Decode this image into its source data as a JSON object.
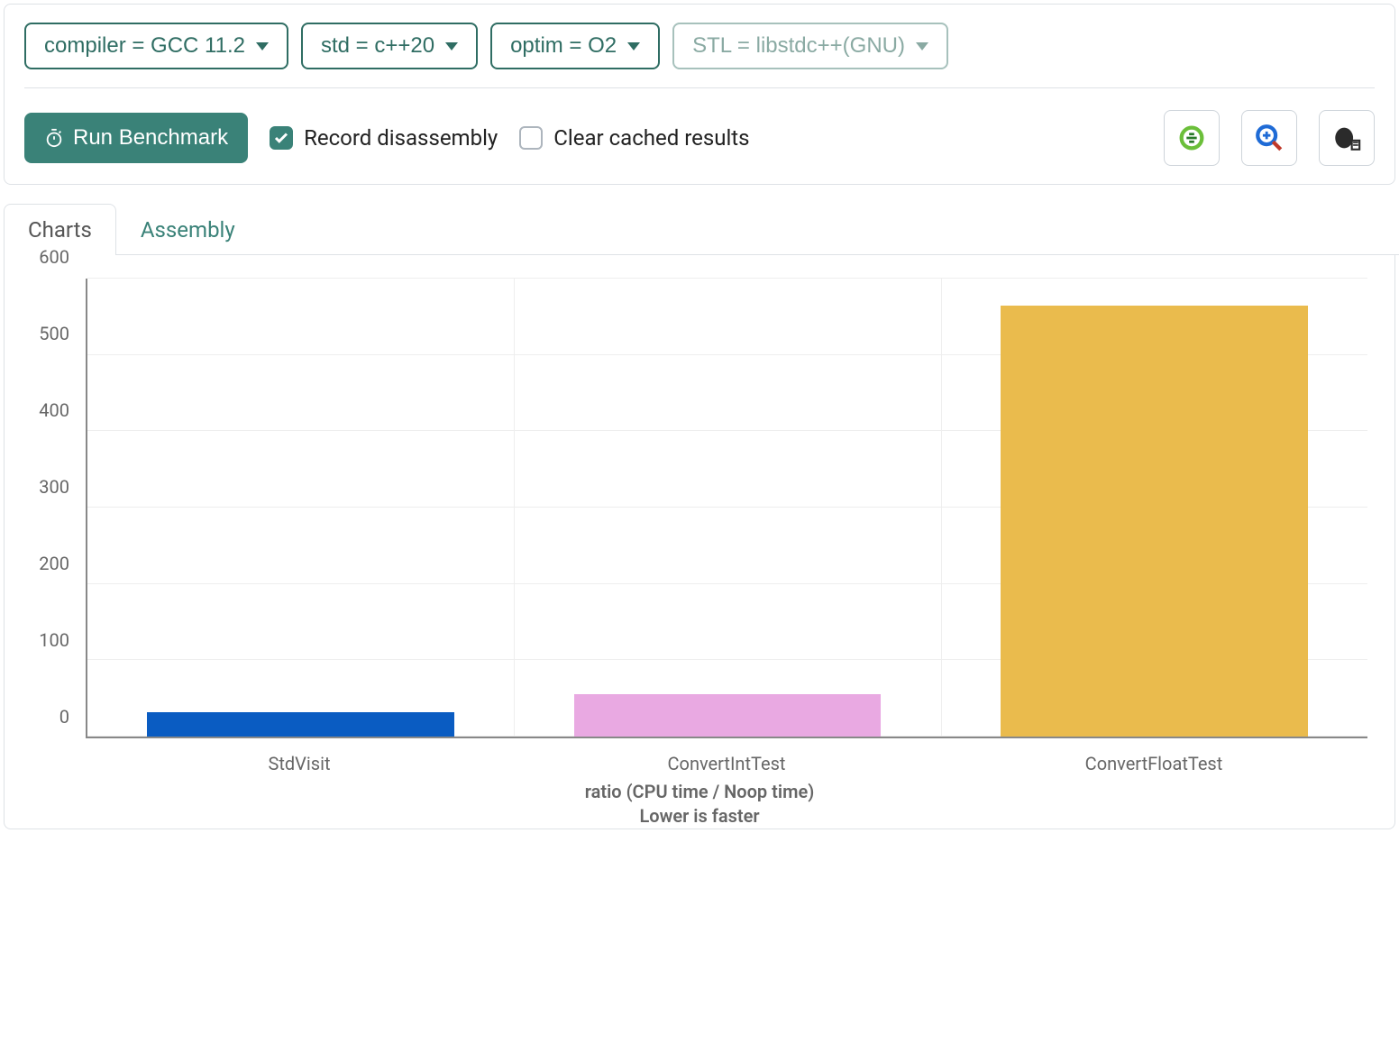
{
  "toolbar": {
    "dropdowns": [
      {
        "label": "compiler = GCC 11.2",
        "disabled": false
      },
      {
        "label": "std = c++20",
        "disabled": false
      },
      {
        "label": "optim = O2",
        "disabled": false
      },
      {
        "label": "STL = libstdc++(GNU)",
        "disabled": true
      }
    ],
    "run_label": "Run Benchmark",
    "record_label": "Record disassembly",
    "record_checked": true,
    "clear_label": "Clear cached results",
    "clear_checked": false
  },
  "tabs": {
    "charts": "Charts",
    "assembly": "Assembly",
    "active": "charts"
  },
  "chart_data": {
    "type": "bar",
    "categories": [
      "StdVisit",
      "ConvertIntTest",
      "ConvertFloatTest"
    ],
    "values": [
      32,
      55,
      565
    ],
    "colors": [
      "#0a5cc2",
      "#e9a9e2",
      "#eabb4d"
    ],
    "ylim": [
      0,
      600
    ],
    "yticks": [
      0,
      100,
      200,
      300,
      400,
      500,
      600
    ],
    "xlabel_line1": "ratio (CPU time / Noop time)",
    "xlabel_line2": "Lower is faster"
  }
}
